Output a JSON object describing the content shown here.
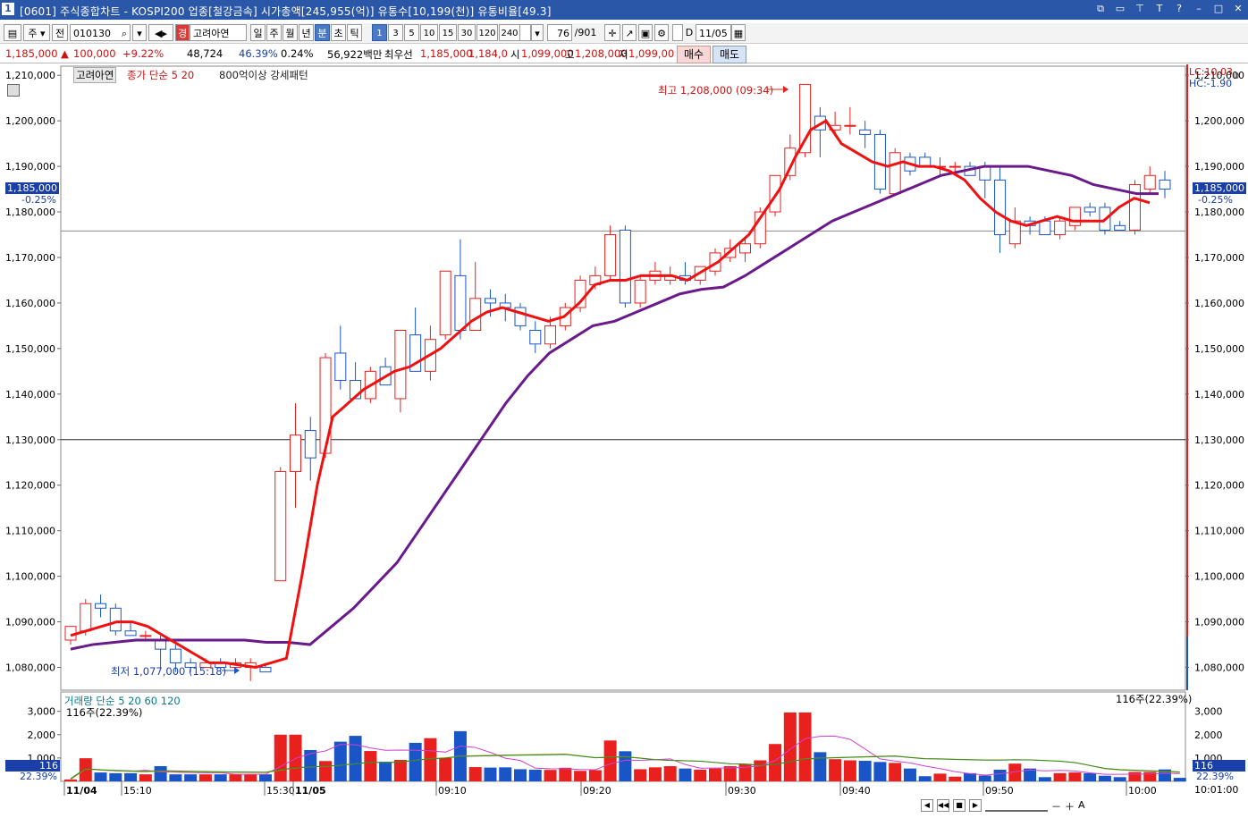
{
  "window": {
    "number": "1",
    "title": "[0601] 주식종합차트 - KOSPI200 업종[철강금속] 시가총액[245,955(억)] 유통수[10,199(천)] 유통비율[49.3]"
  },
  "toolbar": {
    "mode": "주",
    "prev": "전",
    "code": "010130",
    "stock_name_badge": "경",
    "stock_name": "고려아연",
    "periods": [
      "일",
      "주",
      "월",
      "년",
      "분",
      "초",
      "틱"
    ],
    "selected_period": "분",
    "intervals": [
      "1",
      "3",
      "5",
      "10",
      "15",
      "30",
      "120",
      "240"
    ],
    "selected_interval": "1",
    "count_value": "1",
    "range_value": "76",
    "range_total": "/901",
    "date_check_label": "D",
    "date_value": "11/05"
  },
  "quote": {
    "price": "1,185,000",
    "change_arrow": "▲",
    "change": "100,000",
    "change_pct": "+9.22%",
    "volume": "48,724",
    "turnover_pct": "46.39%",
    "vol_pct": "0.24%",
    "amount": "56,922백만",
    "best_bid_label": "최우선",
    "best_bid": "1,185,000",
    "best_ask": "1,184,0",
    "open_label": "시",
    "open": "1,099,000",
    "high_label": "고",
    "high": "1,208,000",
    "low_label": "저",
    "low": "1,099,00",
    "buy_label": "매수",
    "sell_label": "매도"
  },
  "chart": {
    "legend_name": "고려아연",
    "legend_ma": "종가 단순 5  20",
    "legend_pattern": "800억이상 강세패턴",
    "high_label": "최고 1,208,000 (09:34)",
    "low_label": "최저 1,077,000 (15:18)",
    "current_price_tag": "1,185,000",
    "current_pct_tag": "-0.25%",
    "lc_label": "LC:10.03",
    "hc_label": "HC:-1.90",
    "right_axis_extra": "0",
    "y_ticks": [
      "1,210,000",
      "1,200,000",
      "1,190,000",
      "1,180,000",
      "1,170,000",
      "1,160,000",
      "1,150,000",
      "1,140,000",
      "1,130,000",
      "1,120,000",
      "1,110,000",
      "1,100,000",
      "1,090,000",
      "1,080,000"
    ],
    "volume_legend": "거래량  단순 5  20  60  120",
    "volume_sub": "116주(22.39%)",
    "volume_right": "116주(22.39%)",
    "volume_tag": "116",
    "volume_pct_tag": "22.39%",
    "volume_y_ticks": [
      "3,000",
      "2,000",
      "1,000"
    ],
    "x_labels": [
      "11/04",
      "15:10",
      "15:30",
      "11/05",
      "09:10",
      "09:20",
      "09:30",
      "09:40",
      "09:50",
      "10:00"
    ],
    "clock": "10:01:00"
  },
  "colors": {
    "up": "#e8201e",
    "down": "#1a55c8",
    "ma5": "#f01010",
    "ma20": "#6a1a8a",
    "titlebar": "#2b57a8"
  },
  "chart_data": {
    "type": "candlestick",
    "title": "고려아연 1분봉",
    "ma_periods": [
      5,
      20
    ],
    "candles": [
      {
        "o": 1086000,
        "h": 1089000,
        "l": 1085000,
        "c": 1089000
      },
      {
        "o": 1088000,
        "h": 1095000,
        "l": 1087000,
        "c": 1094000
      },
      {
        "o": 1094000,
        "h": 1096000,
        "l": 1091000,
        "c": 1093000
      },
      {
        "o": 1093000,
        "h": 1094000,
        "l": 1087000,
        "c": 1088000
      },
      {
        "o": 1088000,
        "h": 1090000,
        "l": 1087000,
        "c": 1087000
      },
      {
        "o": 1087000,
        "h": 1088000,
        "l": 1086000,
        "c": 1087000
      },
      {
        "o": 1086000,
        "h": 1087000,
        "l": 1080000,
        "c": 1084000
      },
      {
        "o": 1084000,
        "h": 1085000,
        "l": 1079000,
        "c": 1081000
      },
      {
        "o": 1081000,
        "h": 1082000,
        "l": 1079000,
        "c": 1080000
      },
      {
        "o": 1080000,
        "h": 1082000,
        "l": 1080000,
        "c": 1081000
      },
      {
        "o": 1081000,
        "h": 1082000,
        "l": 1080000,
        "c": 1080000
      },
      {
        "o": 1080000,
        "h": 1082000,
        "l": 1080000,
        "c": 1081000
      },
      {
        "o": 1080000,
        "h": 1082000,
        "l": 1077000,
        "c": 1081000
      },
      {
        "o": 1080000,
        "h": 1081000,
        "l": 1079000,
        "c": 1079000
      },
      {
        "o": 1099000,
        "h": 1124000,
        "l": 1099000,
        "c": 1123000
      },
      {
        "o": 1123000,
        "h": 1138000,
        "l": 1115000,
        "c": 1131000
      },
      {
        "o": 1132000,
        "h": 1135000,
        "l": 1121000,
        "c": 1126000
      },
      {
        "o": 1127000,
        "h": 1149000,
        "l": 1126000,
        "c": 1148000
      },
      {
        "o": 1149000,
        "h": 1155000,
        "l": 1141000,
        "c": 1143000
      },
      {
        "o": 1143000,
        "h": 1147000,
        "l": 1140000,
        "c": 1139000
      },
      {
        "o": 1139000,
        "h": 1146000,
        "l": 1138000,
        "c": 1145000
      },
      {
        "o": 1146000,
        "h": 1148000,
        "l": 1142000,
        "c": 1142000
      },
      {
        "o": 1139000,
        "h": 1153000,
        "l": 1136000,
        "c": 1154000
      },
      {
        "o": 1153000,
        "h": 1159000,
        "l": 1145000,
        "c": 1145000
      },
      {
        "o": 1145000,
        "h": 1155000,
        "l": 1143000,
        "c": 1152000
      },
      {
        "o": 1153000,
        "h": 1167000,
        "l": 1152000,
        "c": 1167000
      },
      {
        "o": 1166000,
        "h": 1174000,
        "l": 1152000,
        "c": 1154000
      },
      {
        "o": 1154000,
        "h": 1169000,
        "l": 1154000,
        "c": 1161000
      },
      {
        "o": 1161000,
        "h": 1163000,
        "l": 1157000,
        "c": 1160000
      },
      {
        "o": 1160000,
        "h": 1162000,
        "l": 1156000,
        "c": 1159000
      },
      {
        "o": 1159000,
        "h": 1160000,
        "l": 1154000,
        "c": 1155000
      },
      {
        "o": 1154000,
        "h": 1156000,
        "l": 1149000,
        "c": 1151000
      },
      {
        "o": 1151000,
        "h": 1157000,
        "l": 1150000,
        "c": 1155000
      },
      {
        "o": 1155000,
        "h": 1160000,
        "l": 1154000,
        "c": 1159000
      },
      {
        "o": 1159000,
        "h": 1166000,
        "l": 1158000,
        "c": 1165000
      },
      {
        "o": 1164000,
        "h": 1168000,
        "l": 1163000,
        "c": 1166000
      },
      {
        "o": 1166000,
        "h": 1177000,
        "l": 1165000,
        "c": 1175000
      },
      {
        "o": 1176000,
        "h": 1177000,
        "l": 1159000,
        "c": 1160000
      },
      {
        "o": 1160000,
        "h": 1166000,
        "l": 1159000,
        "c": 1165000
      },
      {
        "o": 1165000,
        "h": 1169000,
        "l": 1164000,
        "c": 1167000
      },
      {
        "o": 1165000,
        "h": 1168000,
        "l": 1164000,
        "c": 1166000
      },
      {
        "o": 1166000,
        "h": 1169000,
        "l": 1164000,
        "c": 1165000
      },
      {
        "o": 1165000,
        "h": 1168000,
        "l": 1164000,
        "c": 1168000
      },
      {
        "o": 1167000,
        "h": 1172000,
        "l": 1166000,
        "c": 1171000
      },
      {
        "o": 1170000,
        "h": 1174000,
        "l": 1169000,
        "c": 1172000
      },
      {
        "o": 1171000,
        "h": 1174000,
        "l": 1169000,
        "c": 1173000
      },
      {
        "o": 1173000,
        "h": 1181000,
        "l": 1172000,
        "c": 1180000
      },
      {
        "o": 1180000,
        "h": 1188000,
        "l": 1179000,
        "c": 1188000
      },
      {
        "o": 1188000,
        "h": 1197000,
        "l": 1187000,
        "c": 1194000
      },
      {
        "o": 1193000,
        "h": 1208000,
        "l": 1192000,
        "c": 1208000
      },
      {
        "o": 1201000,
        "h": 1203000,
        "l": 1192000,
        "c": 1198000
      },
      {
        "o": 1198000,
        "h": 1202000,
        "l": 1197000,
        "c": 1199000
      },
      {
        "o": 1199000,
        "h": 1203000,
        "l": 1197000,
        "c": 1199000
      },
      {
        "o": 1198000,
        "h": 1200000,
        "l": 1194000,
        "c": 1197000
      },
      {
        "o": 1197000,
        "h": 1198000,
        "l": 1184000,
        "c": 1185000
      },
      {
        "o": 1184000,
        "h": 1194000,
        "l": 1184000,
        "c": 1193000
      },
      {
        "o": 1192000,
        "h": 1193000,
        "l": 1188000,
        "c": 1189000
      },
      {
        "o": 1192000,
        "h": 1193000,
        "l": 1190000,
        "c": 1190000
      },
      {
        "o": 1190000,
        "h": 1192000,
        "l": 1188000,
        "c": 1190000
      },
      {
        "o": 1190000,
        "h": 1191000,
        "l": 1188000,
        "c": 1190000
      },
      {
        "o": 1190000,
        "h": 1191000,
        "l": 1188000,
        "c": 1188000
      },
      {
        "o": 1190000,
        "h": 1191000,
        "l": 1183000,
        "c": 1187000
      },
      {
        "o": 1187000,
        "h": 1190000,
        "l": 1171000,
        "c": 1175000
      },
      {
        "o": 1173000,
        "h": 1181000,
        "l": 1172000,
        "c": 1178000
      },
      {
        "o": 1178000,
        "h": 1179000,
        "l": 1175000,
        "c": 1177000
      },
      {
        "o": 1178000,
        "h": 1179000,
        "l": 1175000,
        "c": 1175000
      },
      {
        "o": 1175000,
        "h": 1179000,
        "l": 1174000,
        "c": 1178000
      },
      {
        "o": 1177000,
        "h": 1181000,
        "l": 1176000,
        "c": 1181000
      },
      {
        "o": 1181000,
        "h": 1182000,
        "l": 1179000,
        "c": 1180000
      },
      {
        "o": 1181000,
        "h": 1182000,
        "l": 1175000,
        "c": 1176000
      },
      {
        "o": 1177000,
        "h": 1178000,
        "l": 1176000,
        "c": 1176000
      },
      {
        "o": 1176000,
        "h": 1187000,
        "l": 1175000,
        "c": 1186000
      },
      {
        "o": 1185000,
        "h": 1190000,
        "l": 1184000,
        "c": 1188000
      },
      {
        "o": 1187000,
        "h": 1189000,
        "l": 1183000,
        "c": 1185000
      }
    ],
    "volume": [
      80,
      990,
      380,
      350,
      350,
      300,
      650,
      300,
      300,
      300,
      300,
      300,
      300,
      300,
      2000,
      2000,
      1340,
      870,
      1700,
      1950,
      1300,
      840,
      920,
      1650,
      1850,
      1000,
      2150,
      610,
      590,
      600,
      520,
      500,
      490,
      580,
      450,
      480,
      1750,
      1290,
      520,
      600,
      650,
      550,
      500,
      550,
      650,
      750,
      900,
      1600,
      2950,
      2950,
      1250,
      950,
      900,
      880,
      830,
      790,
      550,
      220,
      330,
      200,
      350,
      250,
      500,
      760,
      550,
      180,
      350,
      380,
      350,
      240,
      180,
      400,
      400,
      510,
      150
    ],
    "ma5": [
      1087000,
      1088000,
      1089000,
      1090000,
      1090000,
      1089000,
      1087000,
      1085000,
      1083000,
      1081000,
      1081000,
      1080500,
      1080000,
      1081000,
      1082000,
      1100000,
      1120000,
      1135000,
      1138000,
      1141000,
      1143000,
      1145000,
      1146000,
      1148000,
      1150000,
      1153000,
      1156000,
      1158000,
      1159000,
      1158000,
      1157000,
      1156000,
      1157000,
      1160000,
      1164000,
      1165000,
      1165000,
      1166000,
      1166000,
      1166000,
      1165000,
      1167000,
      1169000,
      1172000,
      1175000,
      1180000,
      1185000,
      1192000,
      1198000,
      1200000,
      1195000,
      1193000,
      1191000,
      1190000,
      1191000,
      1190000,
      1190000,
      1189000,
      1187000,
      1183000,
      1180000,
      1178000,
      1177000,
      1178000,
      1179000,
      1178000,
      1178000,
      1178000,
      1181000,
      1183000,
      1182000
    ],
    "ma20": [
      1084000,
      1085000,
      1085500,
      1086000,
      1086000,
      1086000,
      1086000,
      1086000,
      1086000,
      1085500,
      1085500,
      1085000,
      1089000,
      1093000,
      1098000,
      1103000,
      1110000,
      1117000,
      1124000,
      1131000,
      1138000,
      1144000,
      1149000,
      1152000,
      1155000,
      1156000,
      1158000,
      1160000,
      1162000,
      1163000,
      1163500,
      1166000,
      1169000,
      1172000,
      1175000,
      1178000,
      1180000,
      1182000,
      1184000,
      1186000,
      1188000,
      1189000,
      1190000,
      1190000,
      1190000,
      1189000,
      1188000,
      1186000,
      1185000,
      1184000,
      1184000
    ],
    "ylim": [
      1075000,
      1212000
    ],
    "reference_lines": [
      1175800,
      1130000
    ]
  }
}
